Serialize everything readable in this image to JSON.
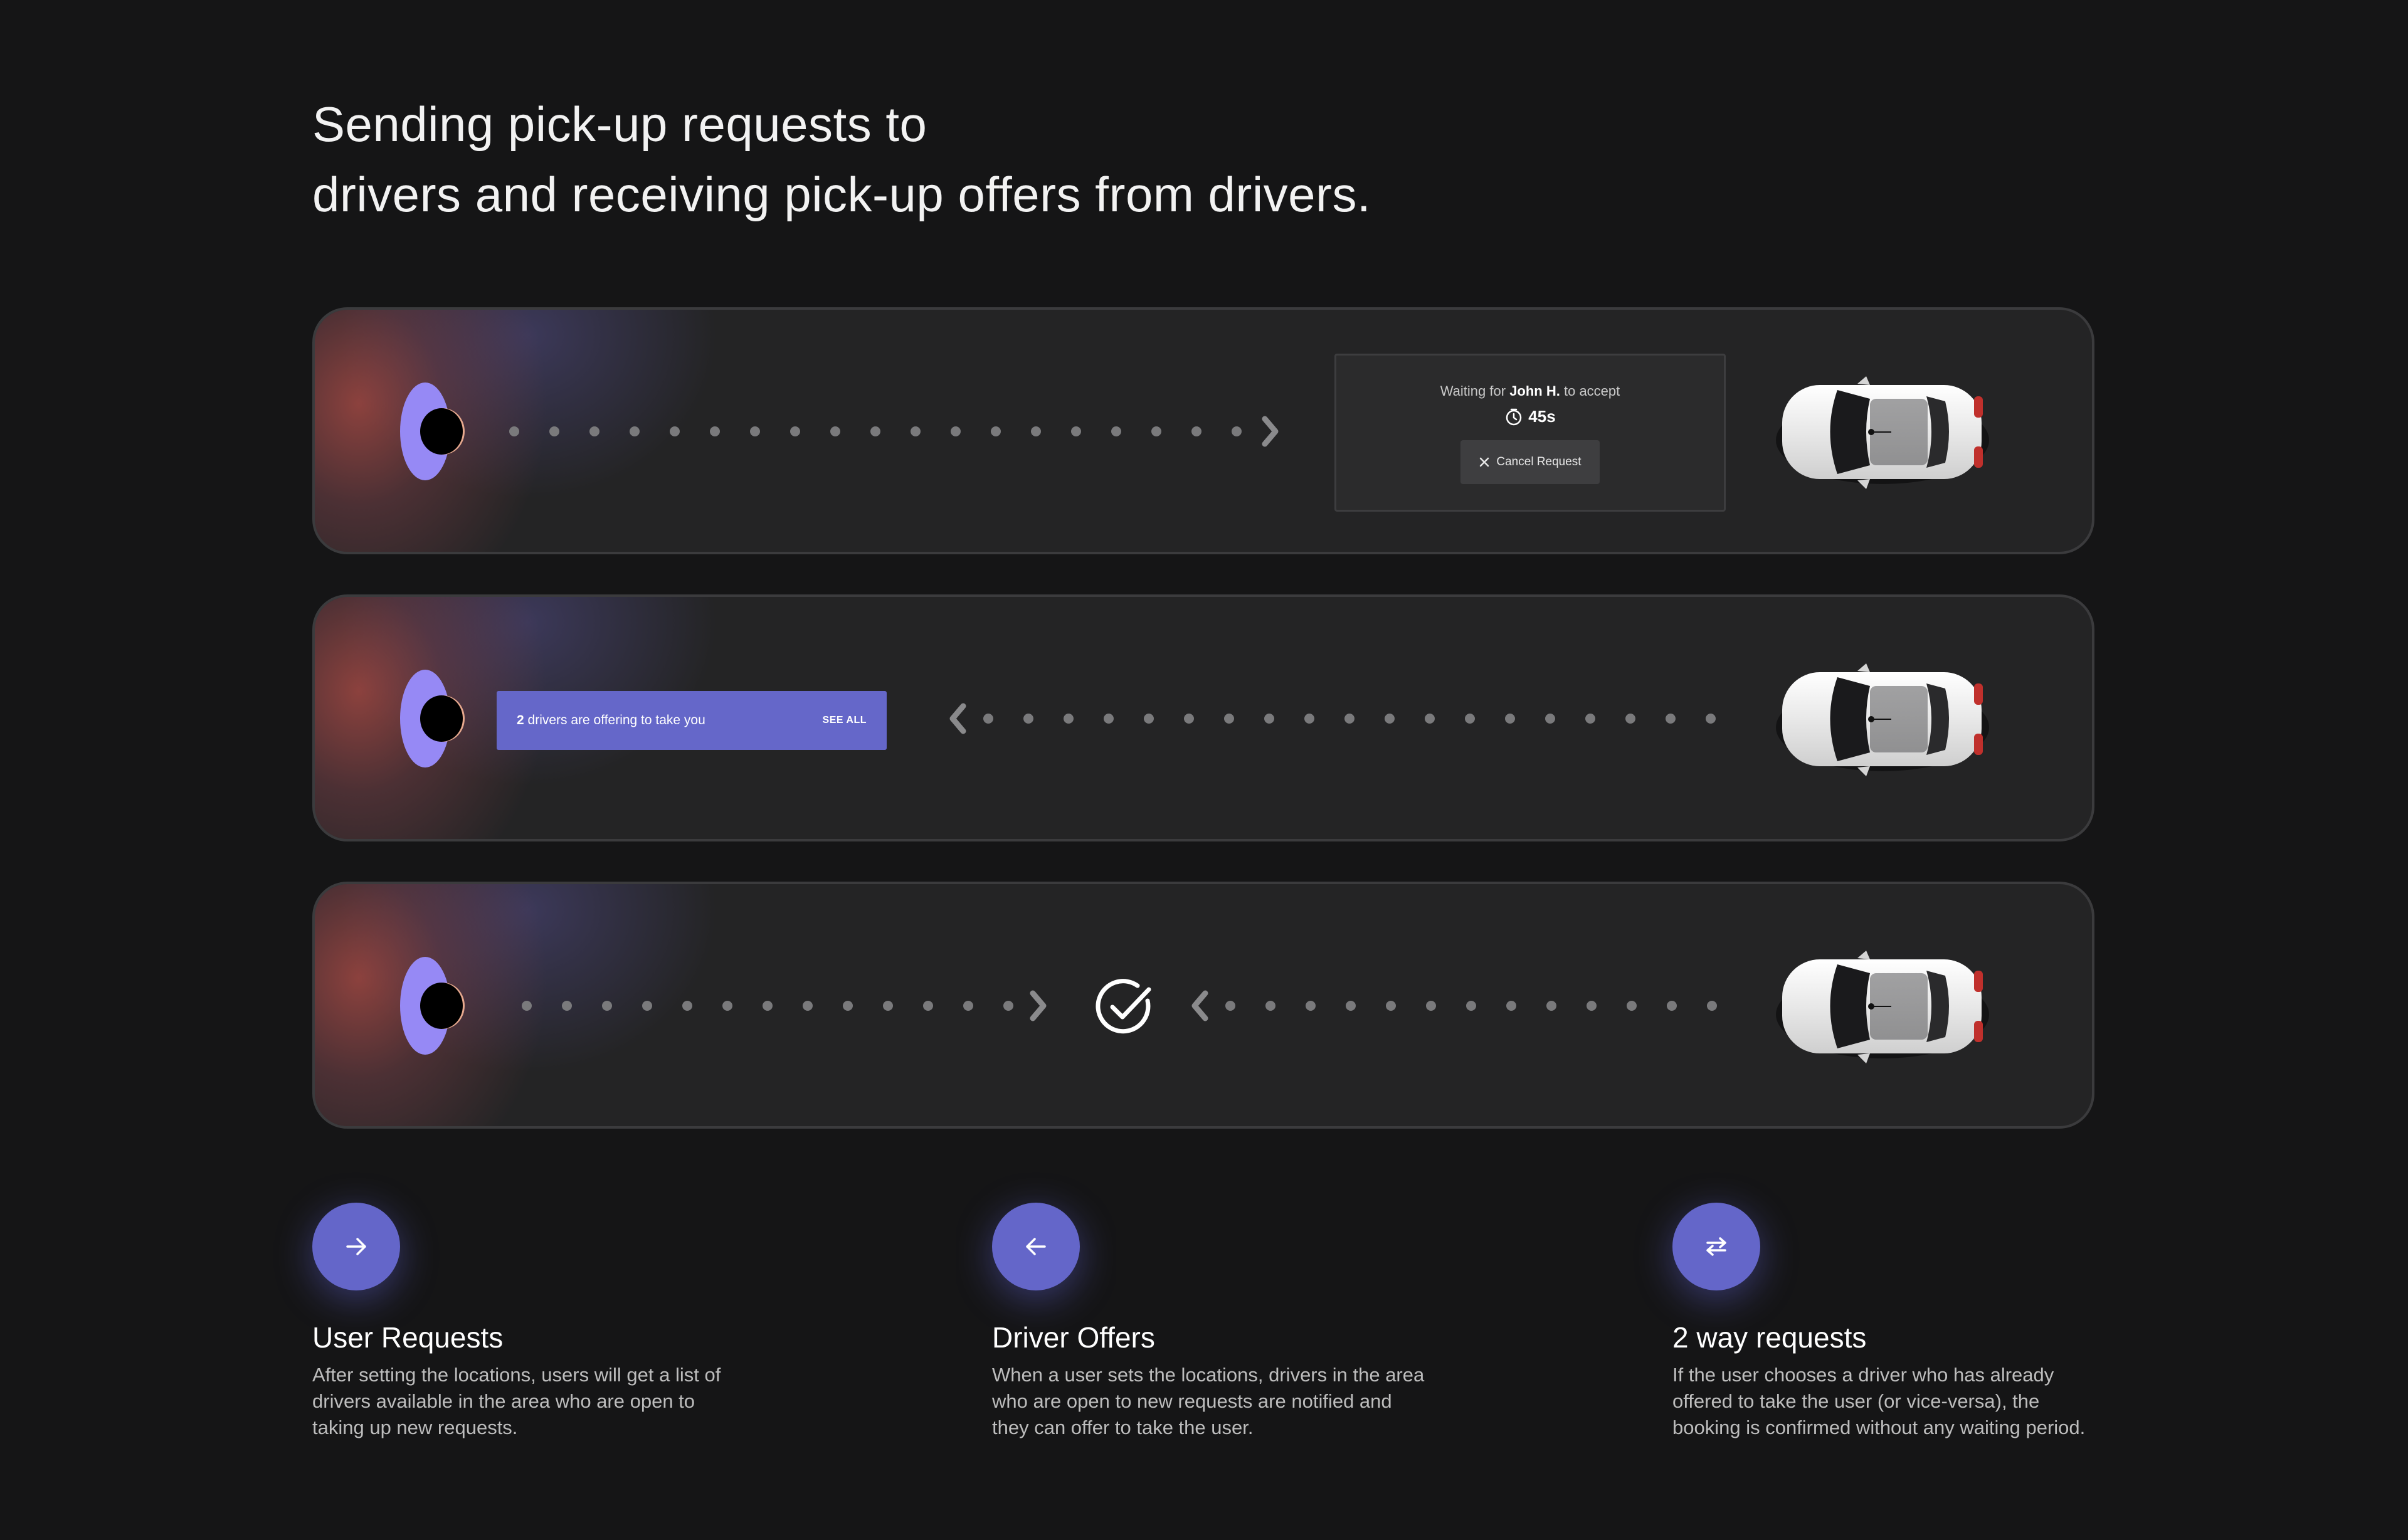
{
  "title": {
    "line1": "Sending pick-up requests to",
    "line2": "drivers and receiving pick-up offers from drivers."
  },
  "colors": {
    "accent": "#6466c9",
    "avatar": "#9689f5",
    "dots": "#7a7a7c",
    "card": "#242425",
    "background": "#151516"
  },
  "card1": {
    "waiting_prefix": "Waiting for",
    "driver_name": "John H.",
    "waiting_suffix": "to accept",
    "timer": "45s",
    "cancel_label": "Cancel Request",
    "icons": [
      "timer-icon",
      "close-icon",
      "chevron-right-icon",
      "car-icon"
    ]
  },
  "card2": {
    "offer_count": "2",
    "offer_text": "drivers are offering to take you",
    "see_all_label": "SEE ALL",
    "icons": [
      "chevron-left-icon",
      "car-icon"
    ]
  },
  "card3": {
    "icons": [
      "chevron-right-icon",
      "check-circle-icon",
      "chevron-left-icon",
      "car-icon"
    ]
  },
  "features": [
    {
      "icon": "arrow-right-icon",
      "title": "User Requests",
      "desc": "After setting the locations, users will get a list of drivers available in the area who are open to taking up new requests."
    },
    {
      "icon": "arrow-left-icon",
      "title": "Driver Offers",
      "desc": "When a user sets the locations, drivers in the area who are open to new requests are notified and they can offer to take the user."
    },
    {
      "icon": "swap-arrows-icon",
      "title": "2 way requests",
      "desc": "If the user chooses a driver who has already offered to take the user (or vice-versa), the booking is confirmed without any waiting period."
    }
  ]
}
